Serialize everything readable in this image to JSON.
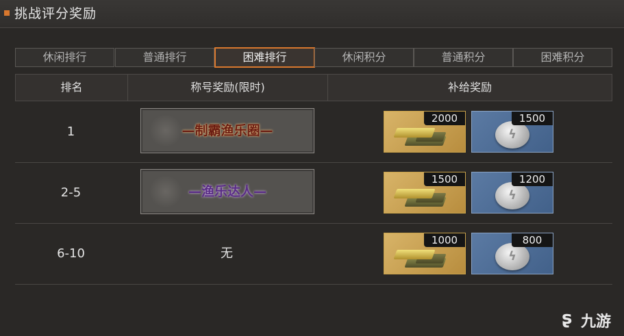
{
  "header": {
    "title": "挑战评分奖励"
  },
  "tabs": [
    {
      "label": "休闲排行",
      "active": false
    },
    {
      "label": "普通排行",
      "active": false
    },
    {
      "label": "困难排行",
      "active": true
    },
    {
      "label": "休闲积分",
      "active": false
    },
    {
      "label": "普通积分",
      "active": false
    },
    {
      "label": "困难积分",
      "active": false
    }
  ],
  "table": {
    "headers": {
      "rank": "排名",
      "title": "称号奖励(限时)",
      "supply": "补给奖励"
    },
    "rows": [
      {
        "rank": "1",
        "title": "—制霸渔乐圈—",
        "title_color": "gold",
        "gold_count": "2000",
        "silver_count": "1500"
      },
      {
        "rank": "2-5",
        "title": "—渔乐达人—",
        "title_color": "purple",
        "gold_count": "1500",
        "silver_count": "1200"
      },
      {
        "rank": "6-10",
        "title": "无",
        "title_color": "none",
        "gold_count": "1000",
        "silver_count": "800"
      }
    ]
  },
  "icons": {
    "gold": "gold-bars-icon",
    "silver": "silver-medal-icon"
  },
  "watermark": {
    "text": "九游"
  },
  "colors": {
    "accent": "#d9782e",
    "background": "#2a2826"
  }
}
